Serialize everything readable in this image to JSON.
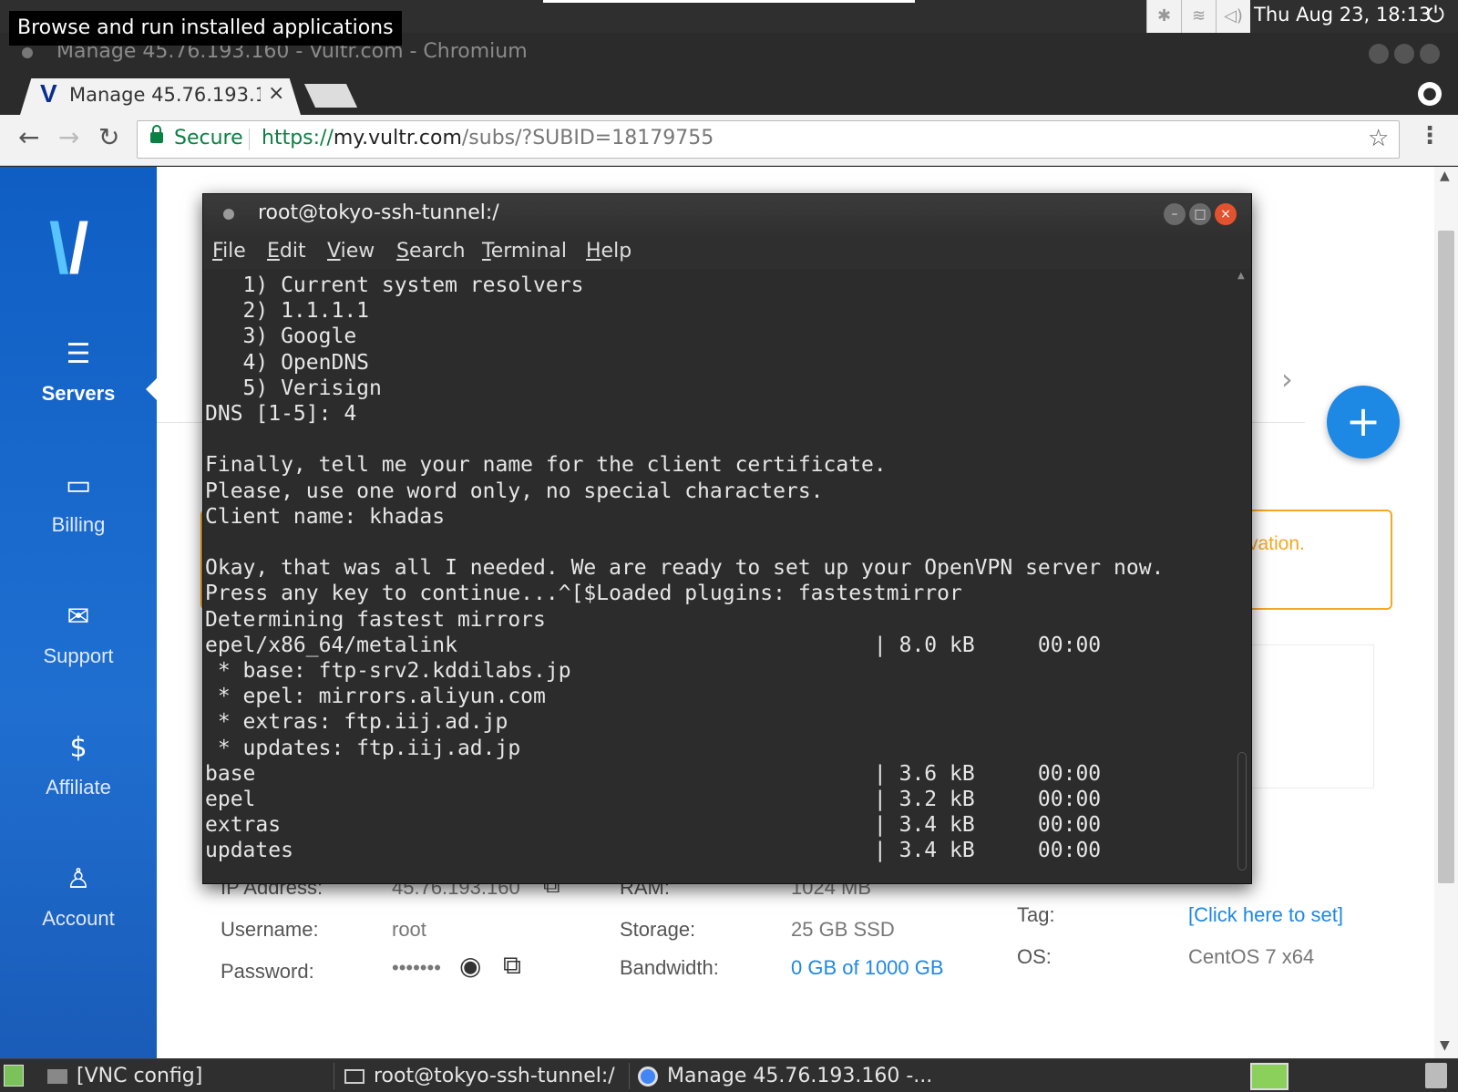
{
  "tooltip": "Browse and run installed applications",
  "top_panel": {
    "clock": "Thu Aug 23, 18:13",
    "tray_icons": [
      "bluetooth-icon",
      "wifi-icon",
      "volume-icon"
    ],
    "power_icon": "⏻"
  },
  "chromium": {
    "window_title": "Manage 45.76.193.160 - Vultr.com - Chromium",
    "tab_label": "Manage 45.76.193.1",
    "tab_close": "×",
    "tab_logo": "V",
    "secure_label": "Secure",
    "url_scheme": "https://",
    "url_host": "my.vultr.com",
    "url_path": "/subs/?SUBID=18179755"
  },
  "sidebar": {
    "items": [
      {
        "label": "Servers",
        "icon": "servers-icon"
      },
      {
        "label": "Billing",
        "icon": "billing-icon"
      },
      {
        "label": "Support",
        "icon": "mail-icon"
      },
      {
        "label": "Affiliate",
        "icon": "dollar-icon"
      },
      {
        "label": "Account",
        "icon": "user-icon"
      }
    ],
    "active": "Servers"
  },
  "page": {
    "warning_text": "vation.",
    "fab_symbol": "+",
    "details": {
      "ip_label": "IP Address:",
      "ip_value": "45.76.193.160",
      "ram_label": "RAM:",
      "ram_value": "1024 MB",
      "username_label": "Username:",
      "username_value": "root",
      "storage_label": "Storage:",
      "storage_value": "25 GB SSD",
      "password_label": "Password:",
      "password_value": "•••••••",
      "bandwidth_label": "Bandwidth:",
      "bandwidth_value": "0 GB of 1000 GB",
      "tag_label": "Tag:",
      "tag_value": "[Click here to set]",
      "os_label": "OS:",
      "os_value": "CentOS 7 x64"
    }
  },
  "terminal": {
    "title": "root@tokyo-ssh-tunnel:/",
    "menu": [
      {
        "u": "F",
        "rest": "ile"
      },
      {
        "u": "E",
        "rest": "dit"
      },
      {
        "u": "V",
        "rest": "iew"
      },
      {
        "u": "S",
        "rest": "earch"
      },
      {
        "u": "T",
        "rest": "erminal"
      },
      {
        "u": "H",
        "rest": "elp"
      }
    ],
    "lines": [
      "   1) Current system resolvers",
      "   2) 1.1.1.1",
      "   3) Google",
      "   4) OpenDNS",
      "   5) Verisign",
      "DNS [1-5]: 4",
      "",
      "Finally, tell me your name for the client certificate.",
      "Please, use one word only, no special characters.",
      "Client name: khadas",
      "",
      "Okay, that was all I needed. We are ready to set up your OpenVPN server now.",
      "Press any key to continue...^[$Loaded plugins: fastestmirror",
      "Determining fastest mirrors",
      "epel/x86_64/metalink                                 | 8.0 kB     00:00",
      " * base: ftp-srv2.kddilabs.jp",
      " * epel: mirrors.aliyun.com",
      " * extras: ftp.iij.ad.jp",
      " * updates: ftp.iij.ad.jp",
      "base                                                 | 3.6 kB     00:00",
      "epel                                                 | 3.2 kB     00:00",
      "extras                                               | 3.4 kB     00:00",
      "updates                                              | 3.4 kB     00:00"
    ]
  },
  "taskbar": {
    "items": [
      "[VNC config]",
      "root@tokyo-ssh-tunnel:/",
      "Manage 45.76.193.160 -..."
    ]
  }
}
